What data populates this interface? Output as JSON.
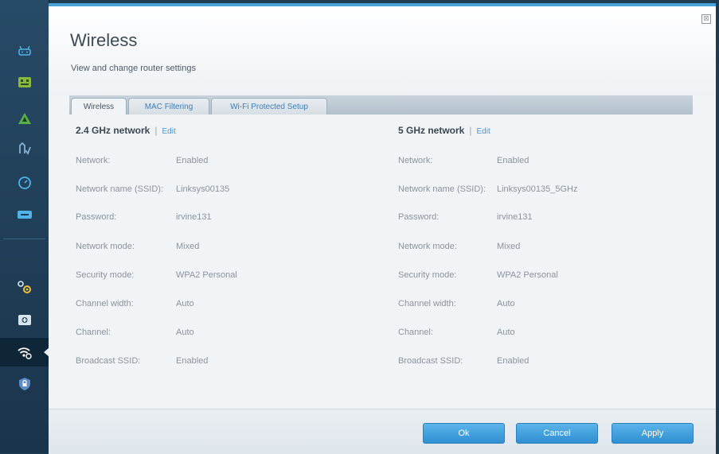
{
  "window": {
    "title": "Wireless",
    "subtitle": "View and change router settings",
    "close_label": "☒"
  },
  "sidebar": {
    "items": [
      {
        "name": "network-map-icon"
      },
      {
        "name": "guest-access-icon"
      },
      {
        "name": "parental-controls-icon"
      },
      {
        "name": "media-prioritization-icon"
      },
      {
        "name": "speed-test-icon"
      },
      {
        "name": "external-storage-icon"
      },
      {
        "name": "connectivity-icon"
      },
      {
        "name": "troubleshooting-icon"
      },
      {
        "name": "wireless-icon",
        "active": true
      },
      {
        "name": "security-icon"
      }
    ]
  },
  "tabs": [
    {
      "label": "Wireless",
      "active": true
    },
    {
      "label": "MAC Filtering",
      "active": false
    },
    {
      "label": "Wi-Fi Protected Setup",
      "active": false
    }
  ],
  "networks": [
    {
      "title": "2.4 GHz network",
      "edit_label": "Edit",
      "rows": [
        {
          "label": "Network:",
          "value": "Enabled"
        },
        {
          "label": "Network name (SSID):",
          "value": "Linksys00135"
        },
        {
          "label": "Password:",
          "value": "irvine131"
        },
        {
          "label": "Network mode:",
          "value": "Mixed"
        },
        {
          "label": "Security mode:",
          "value": "WPA2 Personal"
        },
        {
          "label": "Channel width:",
          "value": "Auto"
        },
        {
          "label": "Channel:",
          "value": "Auto"
        },
        {
          "label": "Broadcast SSID:",
          "value": "Enabled"
        }
      ]
    },
    {
      "title": "5 GHz network",
      "edit_label": "Edit",
      "rows": [
        {
          "label": "Network:",
          "value": "Enabled"
        },
        {
          "label": "Network name (SSID):",
          "value": "Linksys00135_5GHz"
        },
        {
          "label": "Password:",
          "value": "irvine131"
        },
        {
          "label": "Network mode:",
          "value": "Mixed"
        },
        {
          "label": "Security mode:",
          "value": "WPA2 Personal"
        },
        {
          "label": "Channel width:",
          "value": "Auto"
        },
        {
          "label": "Channel:",
          "value": "Auto"
        },
        {
          "label": "Broadcast SSID:",
          "value": "Enabled"
        }
      ]
    }
  ],
  "footer": {
    "ok_label": "Ok",
    "cancel_label": "Cancel",
    "apply_label": "Apply"
  },
  "colors": {
    "accent": "#3d97d6",
    "sidebar": "#23435d"
  }
}
